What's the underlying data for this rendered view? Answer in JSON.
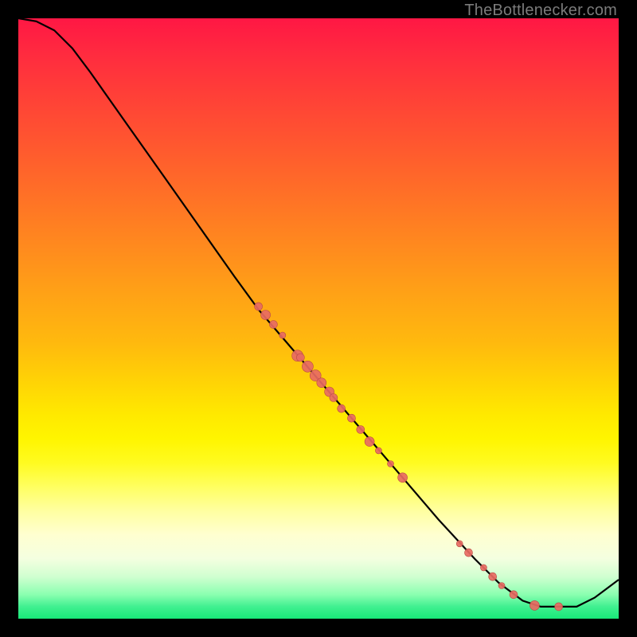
{
  "watermark": "TheBottlenecker.com",
  "colors": {
    "curve": "#000000",
    "point_fill": "#e86a62",
    "point_stroke": "#b94a44"
  },
  "chart_data": {
    "type": "line",
    "title": "",
    "xlabel": "",
    "ylabel": "",
    "xlim": [
      0,
      100
    ],
    "ylim": [
      0,
      100
    ],
    "curve": [
      {
        "x": 0.0,
        "y": 100.0
      },
      {
        "x": 3.0,
        "y": 99.5
      },
      {
        "x": 6.0,
        "y": 98.0
      },
      {
        "x": 9.0,
        "y": 95.0
      },
      {
        "x": 12.0,
        "y": 91.0
      },
      {
        "x": 18.0,
        "y": 82.5
      },
      {
        "x": 24.0,
        "y": 74.0
      },
      {
        "x": 30.0,
        "y": 65.5
      },
      {
        "x": 36.0,
        "y": 57.0
      },
      {
        "x": 40.0,
        "y": 51.5
      },
      {
        "x": 46.0,
        "y": 44.5
      },
      {
        "x": 52.0,
        "y": 37.5
      },
      {
        "x": 58.0,
        "y": 30.5
      },
      {
        "x": 64.0,
        "y": 23.5
      },
      {
        "x": 70.0,
        "y": 16.5
      },
      {
        "x": 76.0,
        "y": 10.0
      },
      {
        "x": 80.0,
        "y": 6.0
      },
      {
        "x": 84.0,
        "y": 3.0
      },
      {
        "x": 87.0,
        "y": 2.0
      },
      {
        "x": 90.0,
        "y": 2.0
      },
      {
        "x": 93.0,
        "y": 2.0
      },
      {
        "x": 96.0,
        "y": 3.5
      },
      {
        "x": 100.0,
        "y": 6.5
      }
    ],
    "points": [
      {
        "x": 40.0,
        "y": 52.0,
        "r": 5
      },
      {
        "x": 41.2,
        "y": 50.6,
        "r": 6
      },
      {
        "x": 42.5,
        "y": 49.0,
        "r": 5
      },
      {
        "x": 44.0,
        "y": 47.2,
        "r": 4
      },
      {
        "x": 46.5,
        "y": 43.8,
        "r": 7
      },
      {
        "x": 47.0,
        "y": 43.5,
        "r": 5
      },
      {
        "x": 48.2,
        "y": 42.0,
        "r": 7
      },
      {
        "x": 49.5,
        "y": 40.5,
        "r": 7
      },
      {
        "x": 50.5,
        "y": 39.3,
        "r": 6
      },
      {
        "x": 51.8,
        "y": 37.8,
        "r": 6
      },
      {
        "x": 52.5,
        "y": 36.8,
        "r": 5
      },
      {
        "x": 53.8,
        "y": 35.0,
        "r": 5
      },
      {
        "x": 55.5,
        "y": 33.4,
        "r": 5
      },
      {
        "x": 57.0,
        "y": 31.5,
        "r": 5
      },
      {
        "x": 58.5,
        "y": 29.5,
        "r": 6
      },
      {
        "x": 60.0,
        "y": 28.0,
        "r": 4
      },
      {
        "x": 62.0,
        "y": 25.8,
        "r": 4
      },
      {
        "x": 64.0,
        "y": 23.5,
        "r": 6
      },
      {
        "x": 73.5,
        "y": 12.5,
        "r": 4
      },
      {
        "x": 75.0,
        "y": 11.0,
        "r": 5
      },
      {
        "x": 77.5,
        "y": 8.5,
        "r": 4
      },
      {
        "x": 79.0,
        "y": 7.0,
        "r": 5
      },
      {
        "x": 80.5,
        "y": 5.5,
        "r": 4
      },
      {
        "x": 82.5,
        "y": 4.0,
        "r": 5
      },
      {
        "x": 86.0,
        "y": 2.2,
        "r": 6
      },
      {
        "x": 90.0,
        "y": 2.0,
        "r": 5
      }
    ]
  }
}
